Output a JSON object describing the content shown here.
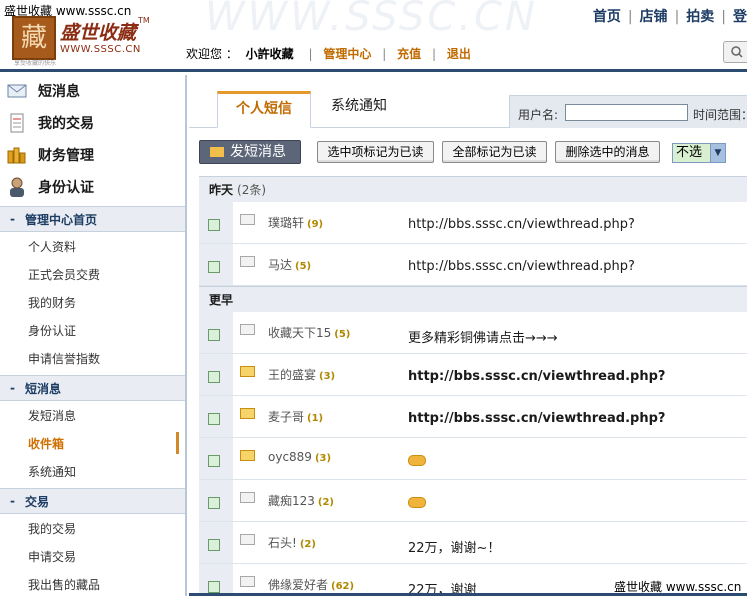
{
  "header": {
    "caption": "盛世收藏 www.sssc.cn",
    "watermark": "WWW.SSSC.CN",
    "logo": {
      "seal": "藏",
      "name_cn": "盛世收藏",
      "tm": "TM",
      "url": "WWW.SSSC.CN",
      "sub": "享受收藏的快乐"
    },
    "nav": [
      "首页",
      "店铺",
      "拍卖",
      "登"
    ],
    "userbar": {
      "welcome": "欢迎您 ：",
      "username": "小許收藏",
      "links": [
        "管理中心",
        "充值",
        "退出"
      ]
    }
  },
  "sidebar": {
    "main_items": [
      {
        "label": "短消息",
        "icon": "envelope-icon"
      },
      {
        "label": "我的交易",
        "icon": "document-icon"
      },
      {
        "label": "财务管理",
        "icon": "coins-icon"
      },
      {
        "label": "身份认证",
        "icon": "id-card-icon"
      }
    ],
    "sections": [
      {
        "title": "管理中心首页",
        "items": [
          "个人资料",
          "正式会员交费",
          "我的财务",
          "身份认证",
          "申请信誉指数"
        ]
      },
      {
        "title": "短消息",
        "items": [
          "发短消息",
          "收件箱",
          "系统通知"
        ],
        "active": "收件箱"
      },
      {
        "title": "交易",
        "items": [
          "我的交易",
          "申请交易",
          "我出售的藏品"
        ]
      }
    ]
  },
  "tabs": [
    {
      "label": "个人短信",
      "active": true
    },
    {
      "label": "系统通知",
      "active": false
    }
  ],
  "filter": {
    "user_label": "用户名:",
    "user_value": "",
    "time_label": "时间范围："
  },
  "actions": {
    "compose": "发短消息",
    "mark_selected": "选中项标记为已读",
    "mark_all": "全部标记为已读",
    "delete": "删除选中的消息",
    "select_value": "不选"
  },
  "groups": [
    {
      "title": "昨天",
      "count": "(2条)",
      "messages": [
        {
          "sender": "璞璐轩",
          "count": "(9)",
          "subject": "http://bbs.sssc.cn/viewthread.php?",
          "unread": false
        },
        {
          "sender": "马达",
          "count": "(5)",
          "subject": "http://bbs.sssc.cn/viewthread.php?",
          "unread": false
        }
      ]
    },
    {
      "title": "更早",
      "count": "",
      "messages": [
        {
          "sender": "收藏天下15",
          "count": "(5)",
          "subject": "更多精彩铜佛请点击→→→",
          "unread": false
        },
        {
          "sender": "王的盛宴",
          "count": "(3)",
          "subject": "http://bbs.sssc.cn/viewthread.php?",
          "unread": true
        },
        {
          "sender": "麦子哥",
          "count": "(1)",
          "subject": "http://bbs.sssc.cn/viewthread.php?",
          "unread": true
        },
        {
          "sender": "oyc889",
          "count": "(3)",
          "subject": "",
          "emoticon": true,
          "unread": true
        },
        {
          "sender": "藏痴123",
          "count": "(2)",
          "subject": "",
          "emoticon": true,
          "unread": false
        },
        {
          "sender": "石头!",
          "count": "(2)",
          "subject": "22万，谢谢~！",
          "unread": false
        },
        {
          "sender": "佛缘爱好者",
          "count": "(62)",
          "subject": "22万，谢谢",
          "unread": false
        }
      ]
    }
  ],
  "footer": {
    "mark": "盛世收藏 www.sssc.cn"
  },
  "colors": {
    "accent": "#c06a00",
    "navy": "#1d3c63",
    "panel": "#e9edf3"
  }
}
